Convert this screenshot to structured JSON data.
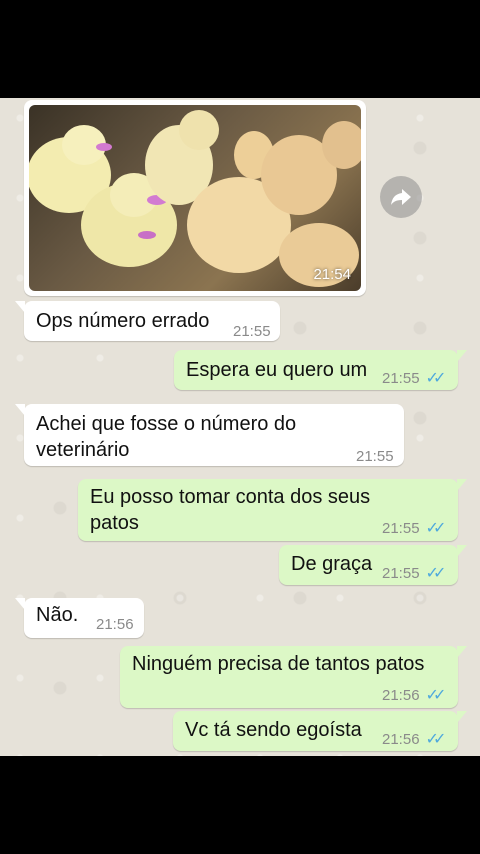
{
  "image_message": {
    "time": "21:54"
  },
  "messages": [
    {
      "dir": "in",
      "text": "Ops número errado",
      "time": "21:55"
    },
    {
      "dir": "out",
      "text": "Espera eu quero um",
      "time": "21:55"
    },
    {
      "dir": "in",
      "text_lines": [
        "Achei que fosse o número do",
        "veterinário"
      ],
      "time": "21:55"
    },
    {
      "dir": "out",
      "text_lines": [
        "Eu posso tomar conta dos seus",
        "patos"
      ],
      "time": "21:55"
    },
    {
      "dir": "out",
      "text": "De graça",
      "time": "21:55"
    },
    {
      "dir": "in",
      "text": "Não.",
      "time": "21:56"
    },
    {
      "dir": "out",
      "text": "Ninguém precisa de tantos patos",
      "time": "21:56"
    },
    {
      "dir": "out",
      "text": "Vc tá sendo egoísta",
      "time": "21:56"
    }
  ],
  "icons": {
    "forward": "forward-icon",
    "read_receipt": "double-check-icon"
  },
  "colors": {
    "incoming": "#ffffff",
    "outgoing": "#dcf8c6",
    "read_ticks": "#4fa9dd",
    "chat_bg": "#e6e2d9"
  }
}
